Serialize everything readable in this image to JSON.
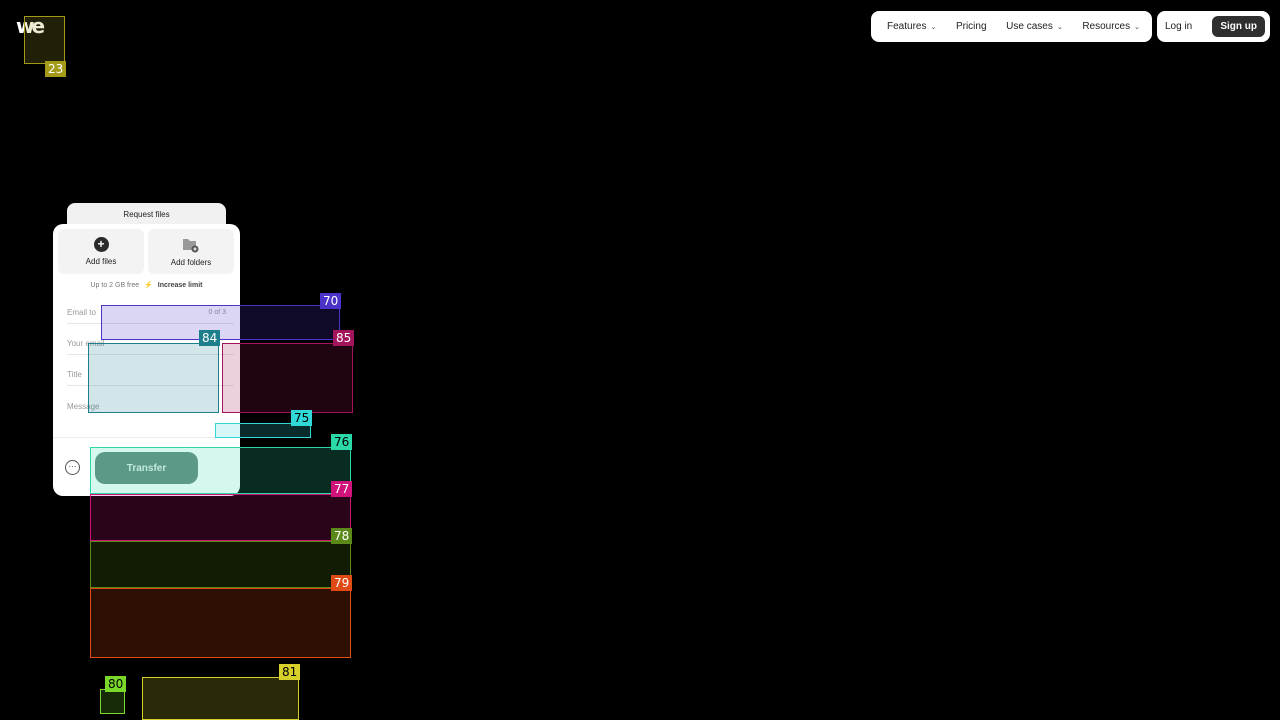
{
  "header": {
    "logo": "we",
    "nav": [
      {
        "label": "Features",
        "dropdown": true
      },
      {
        "label": "Pricing",
        "dropdown": false
      },
      {
        "label": "Use cases",
        "dropdown": true
      },
      {
        "label": "Resources",
        "dropdown": true
      }
    ],
    "login_label": "Log in",
    "signup_label": "Sign up"
  },
  "panel": {
    "request_tab": "Request files",
    "add_files": "Add files",
    "add_folders": "Add folders",
    "limit_text": "Up to 2 GB free",
    "increase_limit": "Increase limit",
    "email_to_placeholder": "Email to",
    "email_count": "0 of 3",
    "your_email_placeholder": "Your email",
    "title_placeholder": "Title",
    "message_placeholder": "Message",
    "transfer_label": "Transfer"
  },
  "overlays": [
    {
      "id": "23",
      "color": "#a39a1a"
    },
    {
      "id": "70",
      "color": "#4b32c8"
    },
    {
      "id": "84",
      "color": "#1e7f8c"
    },
    {
      "id": "85",
      "color": "#a3155a"
    },
    {
      "id": "75",
      "color": "#30d8d8"
    },
    {
      "id": "76",
      "color": "#2ad8a8"
    },
    {
      "id": "77",
      "color": "#d0127a"
    },
    {
      "id": "78",
      "color": "#5c8a1a"
    },
    {
      "id": "79",
      "color": "#e04a14"
    },
    {
      "id": "80",
      "color": "#7ad82a"
    },
    {
      "id": "81",
      "color": "#d8d02a"
    }
  ]
}
